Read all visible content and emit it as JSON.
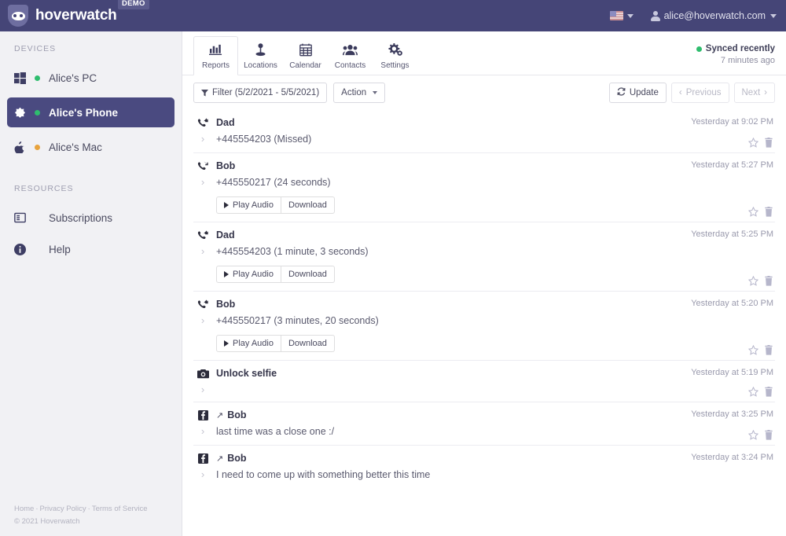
{
  "header": {
    "brand": "hoverwatch",
    "demo_badge": "DEMO",
    "logo_icon": "owl-shield-logo",
    "flag_icon": "us-flag-icon",
    "user_icon": "user-icon",
    "user_email": "alice@hoverwatch.com",
    "bg_color": "#454577"
  },
  "sidebar": {
    "devices_title": "DEVICES",
    "resources_title": "RESOURCES",
    "devices": [
      {
        "label": "Alice's PC",
        "icon": "windows-icon",
        "status": "online",
        "status_color": "#2fbd6e",
        "active": false
      },
      {
        "label": "Alice's Phone",
        "icon": "android-icon",
        "status": "online",
        "status_color": "#2fbd6e",
        "active": true
      },
      {
        "label": "Alice's Mac",
        "icon": "apple-icon",
        "status": "idle",
        "status_color": "#e8a33d",
        "active": false
      }
    ],
    "resources": [
      {
        "label": "Subscriptions",
        "icon": "card-icon"
      },
      {
        "label": "Help",
        "icon": "info-icon"
      }
    ],
    "footer": {
      "links": [
        "Home",
        "Privacy Policy",
        "Terms of Service"
      ],
      "separator": "·",
      "copyright": "© 2021 Hoverwatch"
    },
    "active_color": "#4a4a80"
  },
  "tabs": [
    {
      "label": "Reports",
      "icon": "bar-chart-icon",
      "active": true
    },
    {
      "label": "Locations",
      "icon": "map-pin-icon",
      "active": false
    },
    {
      "label": "Calendar",
      "icon": "calendar-icon",
      "active": false
    },
    {
      "label": "Contacts",
      "icon": "contacts-icon",
      "active": false
    },
    {
      "label": "Settings",
      "icon": "gear-icon",
      "active": false
    }
  ],
  "sync": {
    "status": "Synced recently",
    "status_color": "#2fbd6e",
    "time_ago": "7 minutes ago"
  },
  "toolbar": {
    "filter_label": "Filter (5/2/2021 - 5/5/2021)",
    "filter_icon": "funnel-icon",
    "action_label": "Action",
    "update_label": "Update",
    "update_icon": "refresh-icon",
    "previous_label": "Previous",
    "next_label": "Next"
  },
  "row_actions": {
    "star_icon": "star-icon",
    "trash_icon": "trash-icon",
    "expand_icon": "chevron-right-icon"
  },
  "media": {
    "play_label": "Play Audio",
    "play_icon": "play-icon",
    "download_label": "Download"
  },
  "log_entries": [
    {
      "type_icon": "call-missed-icon",
      "title": "Dad",
      "detail": "+445554203 (Missed)",
      "timestamp": "Yesterday at 9:02 PM",
      "has_media": false,
      "direction": ""
    },
    {
      "type_icon": "call-outgoing-icon",
      "title": "Bob",
      "detail": "+445550217 (24 seconds)",
      "timestamp": "Yesterday at 5:27 PM",
      "has_media": true,
      "direction": ""
    },
    {
      "type_icon": "call-missed-icon",
      "title": "Dad",
      "detail": "+445554203 (1 minute, 3 seconds)",
      "timestamp": "Yesterday at 5:25 PM",
      "has_media": true,
      "direction": ""
    },
    {
      "type_icon": "call-missed-icon",
      "title": "Bob",
      "detail": "+445550217 (3 minutes, 20 seconds)",
      "timestamp": "Yesterday at 5:20 PM",
      "has_media": true,
      "direction": ""
    },
    {
      "type_icon": "camera-icon",
      "title": "Unlock selfie",
      "detail": "",
      "timestamp": "Yesterday at 5:19 PM",
      "has_media": false,
      "direction": ""
    },
    {
      "type_icon": "facebook-icon",
      "title": "Bob",
      "detail": "last time was a close one :/",
      "timestamp": "Yesterday at 3:25 PM",
      "has_media": false,
      "direction": "↗"
    },
    {
      "type_icon": "facebook-icon",
      "title": "Bob",
      "detail": "I need to come up with something better this time",
      "timestamp": "Yesterday at 3:24 PM",
      "has_media": false,
      "direction": "↗"
    }
  ]
}
